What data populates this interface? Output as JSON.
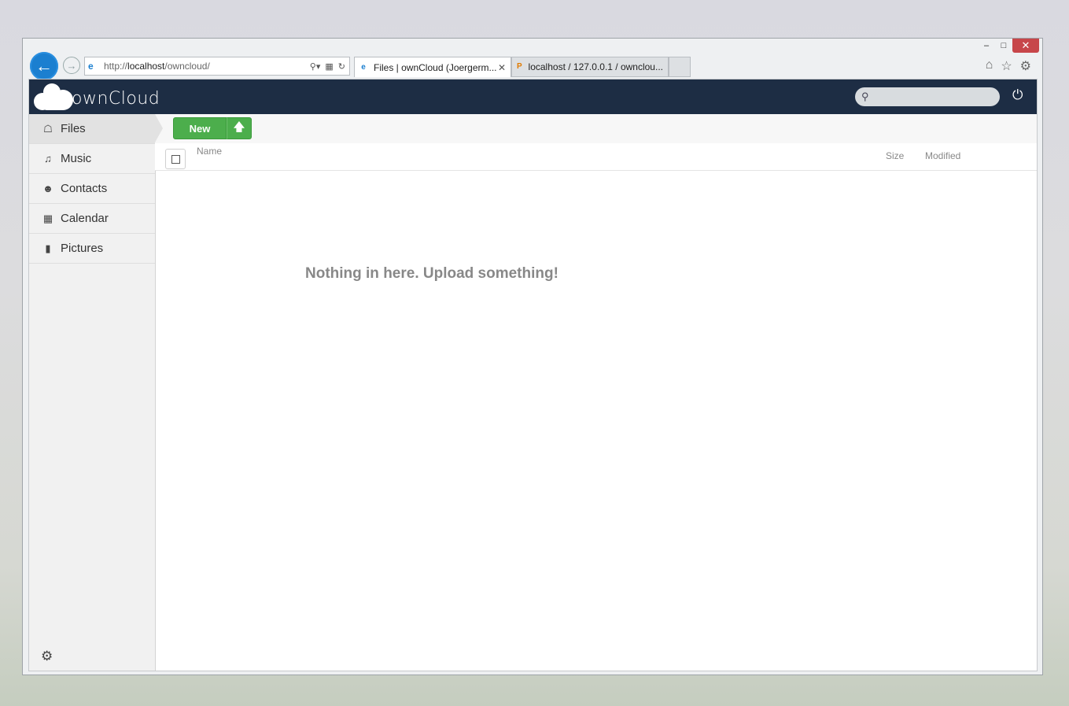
{
  "browser": {
    "address": {
      "prefix": "http://",
      "host": "localhost",
      "path": "/owncloud/"
    },
    "tabs": [
      {
        "label": "Files | ownCloud (Joergerm...",
        "active": true
      },
      {
        "label": "localhost / 127.0.0.1 / ownclou...",
        "active": false
      }
    ],
    "window_controls": {
      "minimize": "–",
      "maximize": "□",
      "close": "✕"
    }
  },
  "header": {
    "logo_text": "ownCloud",
    "search_placeholder": ""
  },
  "sidebar": {
    "items": [
      {
        "label": "Files",
        "icon": "home-icon",
        "active": true
      },
      {
        "label": "Music",
        "icon": "music-icon"
      },
      {
        "label": "Contacts",
        "icon": "contacts-icon"
      },
      {
        "label": "Calendar",
        "icon": "calendar-icon"
      },
      {
        "label": "Pictures",
        "icon": "pictures-icon"
      }
    ]
  },
  "toolbar": {
    "new_label": "New",
    "upload_icon": "upload-icon"
  },
  "table": {
    "columns": {
      "name": "Name",
      "size": "Size",
      "modified": "Modified"
    }
  },
  "empty_message": "Nothing in here. Upload something!",
  "colors": {
    "header_bg": "#1d2d44",
    "button_green": "#4cae4c",
    "ie_blue": "#1b7fd0",
    "close_red": "#c7464a"
  }
}
